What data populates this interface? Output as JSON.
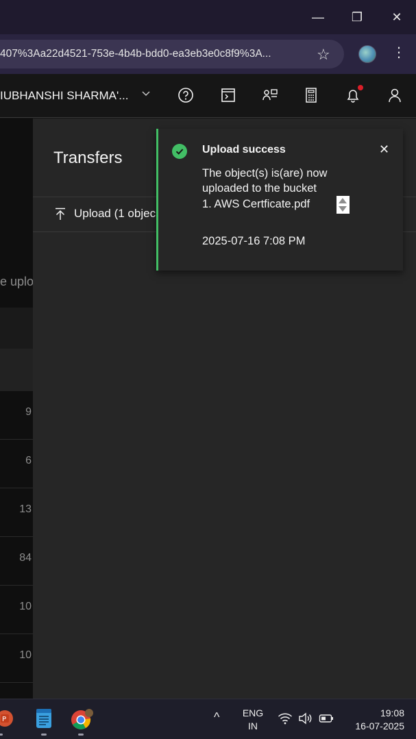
{
  "window_controls": {
    "minimize": "—",
    "restore": "❐",
    "close": "✕"
  },
  "browser": {
    "url": "407%3Aa22d4521-753e-4b4b-bdd0-ea3eb3e0c8f9%3A...",
    "star_glyph": "☆",
    "menu_glyph": "⋮"
  },
  "header": {
    "account": "IUBHANSHI SHARMA'...",
    "chevron": "⌄",
    "icons": [
      "help-icon",
      "terminal-icon",
      "switcher-icon",
      "calculator-icon",
      "notification-icon",
      "user-icon"
    ]
  },
  "background": {
    "upload_text": "e uplo",
    "row_values": [
      "9",
      "6",
      "13",
      "84",
      "10",
      "10"
    ]
  },
  "transfers": {
    "title": "Transfers",
    "upload_label": "Upload (1 objec"
  },
  "toast": {
    "title": "Upload success",
    "message": "The object(s) is(are) now uploaded to the bucket",
    "file": "1. AWS Certficate.pdf",
    "timestamp": "2025-07-16 7:08 PM",
    "close_glyph": "✕",
    "accent": "#42be65"
  },
  "taskbar": {
    "apps": [
      "powerpoint-icon",
      "notepad-icon",
      "chrome-icon"
    ],
    "tray_chevron": "^",
    "lang_line1": "ENG",
    "lang_line2": "IN",
    "time": "19:08",
    "date": "16-07-2025"
  }
}
